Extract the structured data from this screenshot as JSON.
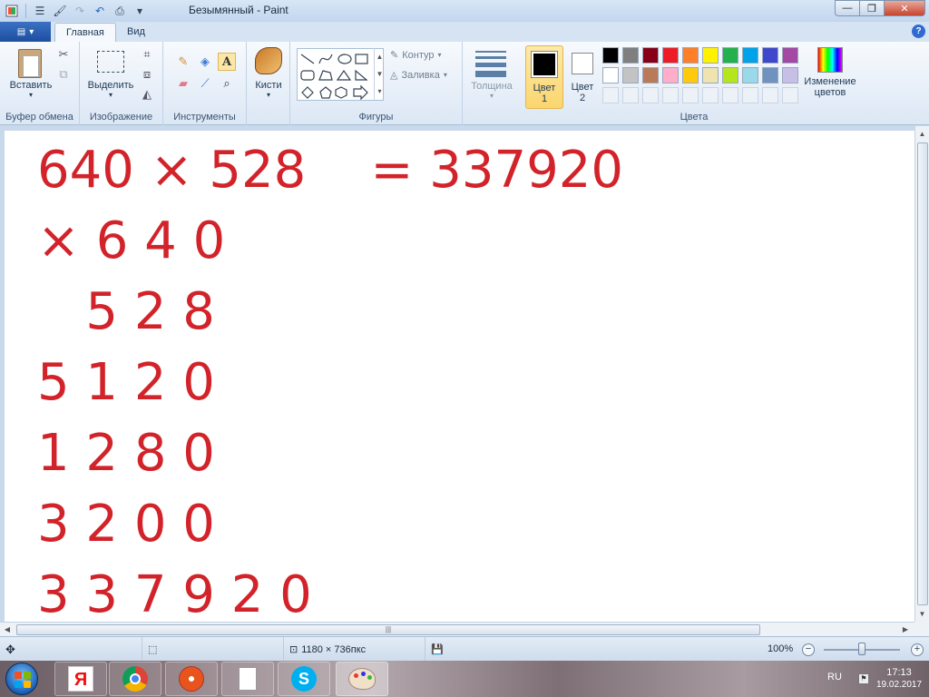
{
  "window": {
    "title": "Безымянный - Paint"
  },
  "tabs": [
    {
      "label": "Главная"
    },
    {
      "label": "Вид"
    }
  ],
  "ribbon": {
    "clipboard": {
      "paste_label": "Вставить",
      "group_label": "Буфер обмена"
    },
    "image": {
      "select_label": "Выделить",
      "group_label": "Изображение"
    },
    "tools": {
      "group_label": "Инструменты",
      "text_tool_glyph": "A"
    },
    "brushes": {
      "label": "Кисти"
    },
    "shapes": {
      "group_label": "Фигуры",
      "outline_label": "Контур",
      "fill_label": "Заливка"
    },
    "size": {
      "label": "Толщина"
    },
    "colors": {
      "group_label": "Цвета",
      "color1_label": "Цвет",
      "color1_num": "1",
      "color2_label": "Цвет",
      "color2_num": "2",
      "edit_label_1": "Изменение",
      "edit_label_2": "цветов",
      "color1_value": "#000000",
      "color2_value": "#ffffff",
      "palette": [
        "#000000",
        "#7f7f7f",
        "#880015",
        "#ed1c24",
        "#ff7f27",
        "#fff200",
        "#22b14c",
        "#00a2e8",
        "#3f48cc",
        "#a349a4",
        "#ffffff",
        "#c3c3c3",
        "#b97a57",
        "#ffaec9",
        "#ffc90e",
        "#efe4b0",
        "#b5e61d",
        "#99d9ea",
        "#7092be",
        "#c8bfe7"
      ]
    }
  },
  "canvas": {
    "text_color": "#d2232a",
    "lines": [
      "640 × 528    = 337920",
      "× 6 4 0",
      "   5 2 8",
      "5 1 2 0",
      "1 2 8 0",
      "3 2 0 0",
      "3 3 7 9 2 0"
    ]
  },
  "status": {
    "dimensions": "1180 × 736пкс",
    "zoom": "100%"
  },
  "taskbar": {
    "language": "RU",
    "time": "17:13",
    "date": "19.02.2017"
  }
}
